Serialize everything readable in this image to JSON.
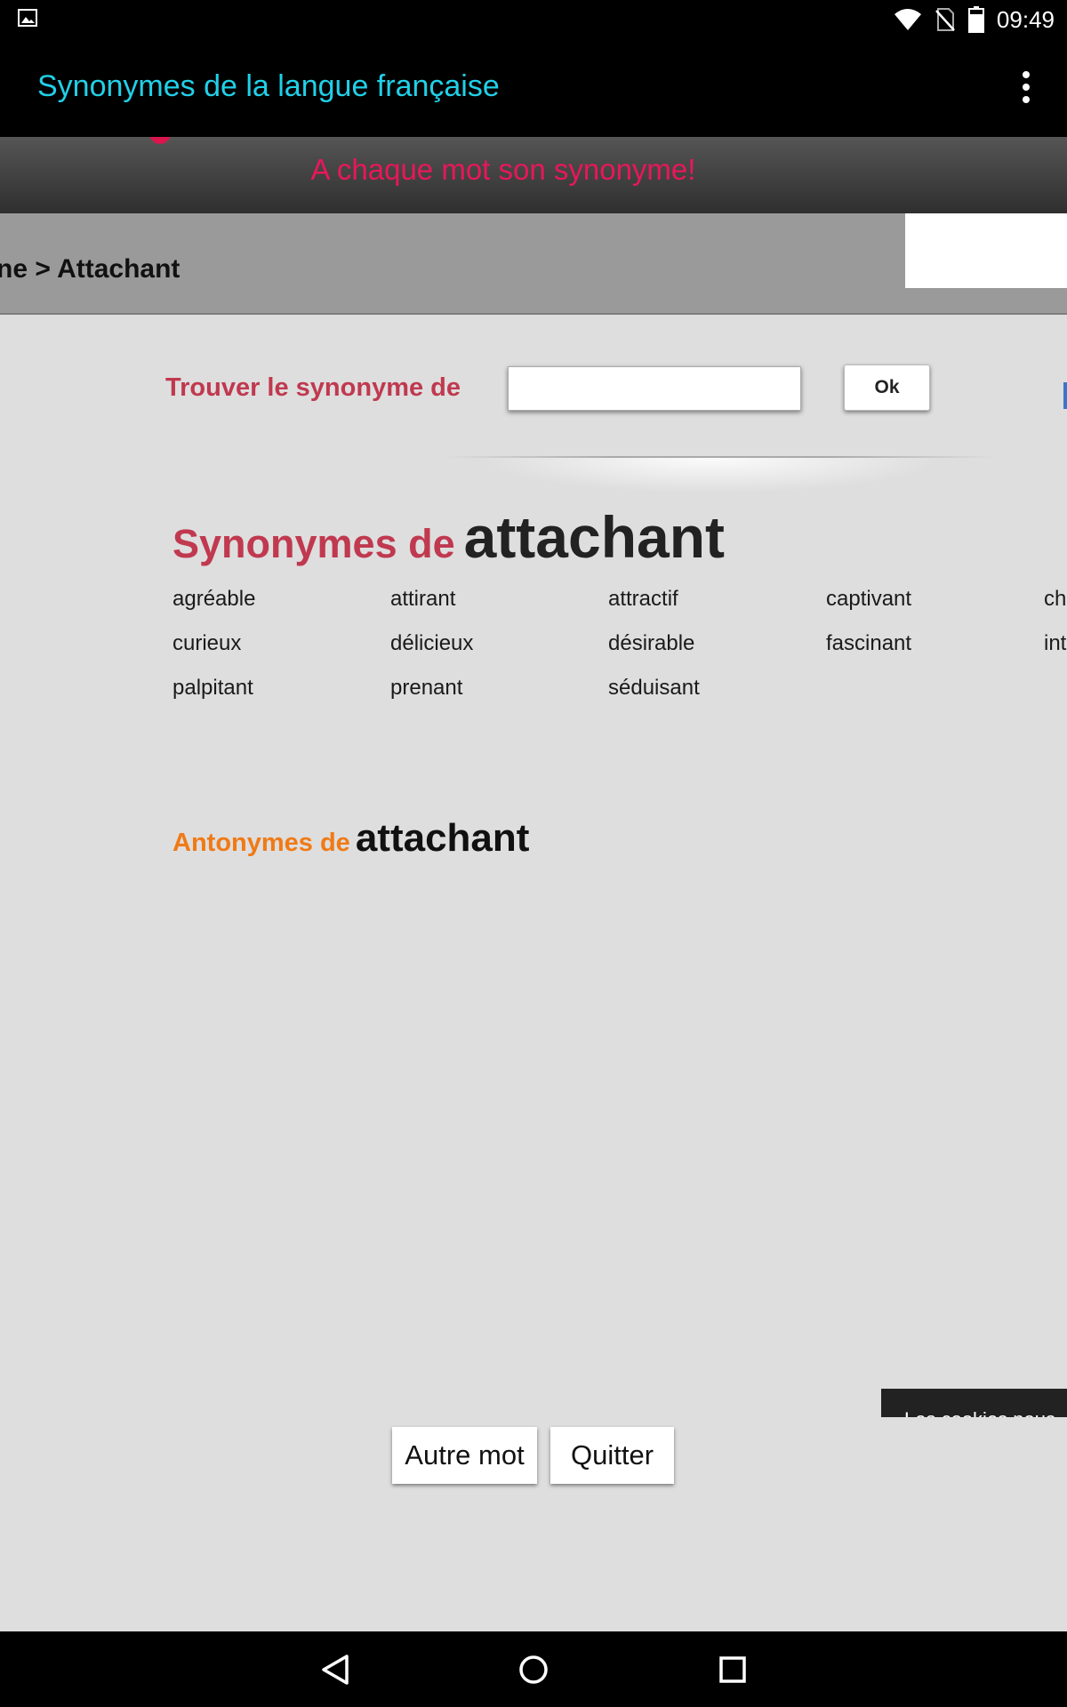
{
  "status_bar": {
    "time": "09:49",
    "icons": [
      "gallery-icon",
      "wifi-icon",
      "no-sim-icon",
      "battery-icon"
    ]
  },
  "action_bar": {
    "title": "Synonymes de la langue française",
    "title_color": "#21d0e8",
    "menu_icon": "overflow-menu-icon"
  },
  "site_header": {
    "tagline": "A chaque mot son synonyme!",
    "tagline_color": "#e8175a"
  },
  "breadcrumb": {
    "text": "ne > Attachant"
  },
  "search": {
    "label": "Trouver le synonyme de",
    "placeholder": "",
    "value": "",
    "button_label": "Ok"
  },
  "synonyms": {
    "prefix": "Synonymes de",
    "word": "attachant",
    "columns": 5,
    "items": [
      "agréable",
      "attirant",
      "attractif",
      "captivant",
      "ch",
      "curieux",
      "délicieux",
      "désirable",
      "fascinant",
      "int",
      "palpitant",
      "prenant",
      "séduisant"
    ]
  },
  "antonyms": {
    "prefix": "Antonymes de",
    "word": "attachant",
    "items": []
  },
  "cookie_banner": {
    "text": "Les cookies nous"
  },
  "buttons": {
    "other_word": "Autre mot",
    "quit": "Quitter"
  },
  "colors": {
    "page_background": "#dedede",
    "heading_red": "#c0394f",
    "antonym_orange": "#f07a16"
  },
  "nav_bar": {
    "icons": [
      "back-icon",
      "home-icon",
      "recents-icon"
    ]
  }
}
